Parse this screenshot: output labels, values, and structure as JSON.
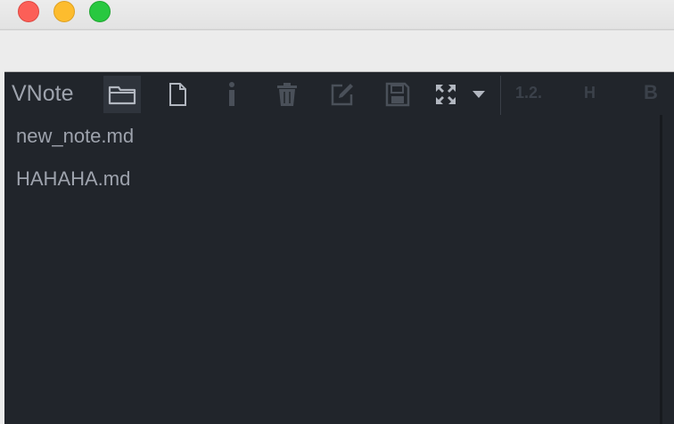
{
  "window": {
    "traffic_lights": [
      {
        "name": "close",
        "color": "#fc5f57"
      },
      {
        "name": "minimize",
        "color": "#fdbc2e"
      },
      {
        "name": "zoom",
        "color": "#28c840"
      }
    ]
  },
  "app": {
    "name": "VNote",
    "background": "#21252b",
    "text_color": "#9ea3ad"
  },
  "toolbar": {
    "buttons": [
      {
        "icon": "folder-icon",
        "active": true
      },
      {
        "icon": "new-file-icon"
      },
      {
        "icon": "info-icon"
      },
      {
        "icon": "trash-icon"
      },
      {
        "icon": "edit-icon"
      },
      {
        "icon": "save-icon"
      },
      {
        "icon": "expand-icon"
      },
      {
        "icon": "caret-down-icon"
      }
    ],
    "ordered_list_label": "1.2.",
    "heading_label": "H",
    "bold_label": "B"
  },
  "files": [
    {
      "name": "new_note.md"
    },
    {
      "name": "HAHAHA.md"
    }
  ]
}
